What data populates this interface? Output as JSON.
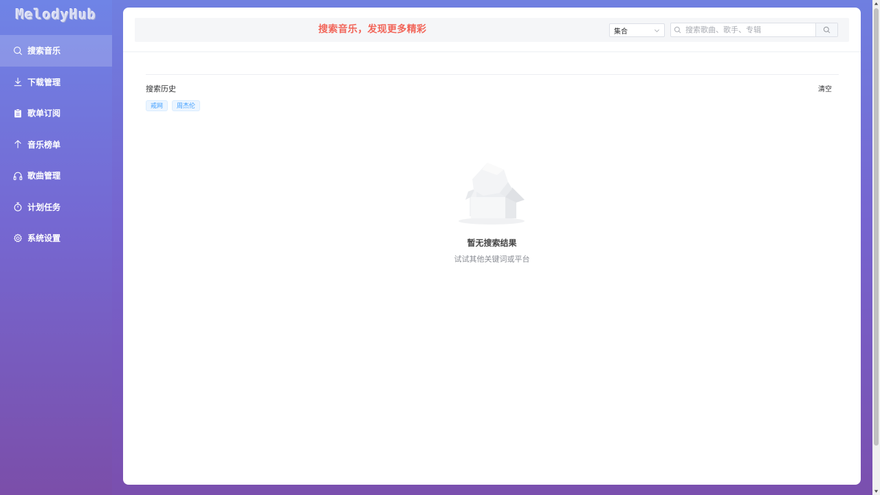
{
  "app": {
    "logo": "MelodyHub"
  },
  "sidebar": {
    "items": [
      {
        "label": "搜索音乐",
        "icon": "search-icon",
        "active": true
      },
      {
        "label": "下载管理",
        "icon": "download-icon",
        "active": false
      },
      {
        "label": "歌单订阅",
        "icon": "clipboard-icon",
        "active": false
      },
      {
        "label": "音乐榜单",
        "icon": "arrow-up-icon",
        "active": false
      },
      {
        "label": "歌曲管理",
        "icon": "headphones-icon",
        "active": false
      },
      {
        "label": "计划任务",
        "icon": "timer-icon",
        "active": false
      },
      {
        "label": "系统设置",
        "icon": "gear-icon",
        "active": false
      }
    ]
  },
  "header": {
    "headline": "搜索音乐，发现更多精彩",
    "source_select": {
      "value": "集合"
    },
    "search": {
      "value": "",
      "placeholder": "搜索歌曲、歌手、专辑"
    }
  },
  "history": {
    "title": "搜索历史",
    "clear_label": "清空",
    "tags": [
      "戒网",
      "周杰伦"
    ]
  },
  "empty": {
    "title": "暂无搜索结果",
    "subtitle": "试试其他关键词或平台"
  },
  "colors": {
    "headline": "#f2665a",
    "tag_text": "#409eff",
    "tag_bg": "#ecf5ff",
    "sidebar_top": "#6f84e6",
    "sidebar_bottom": "#7b4ea9"
  }
}
